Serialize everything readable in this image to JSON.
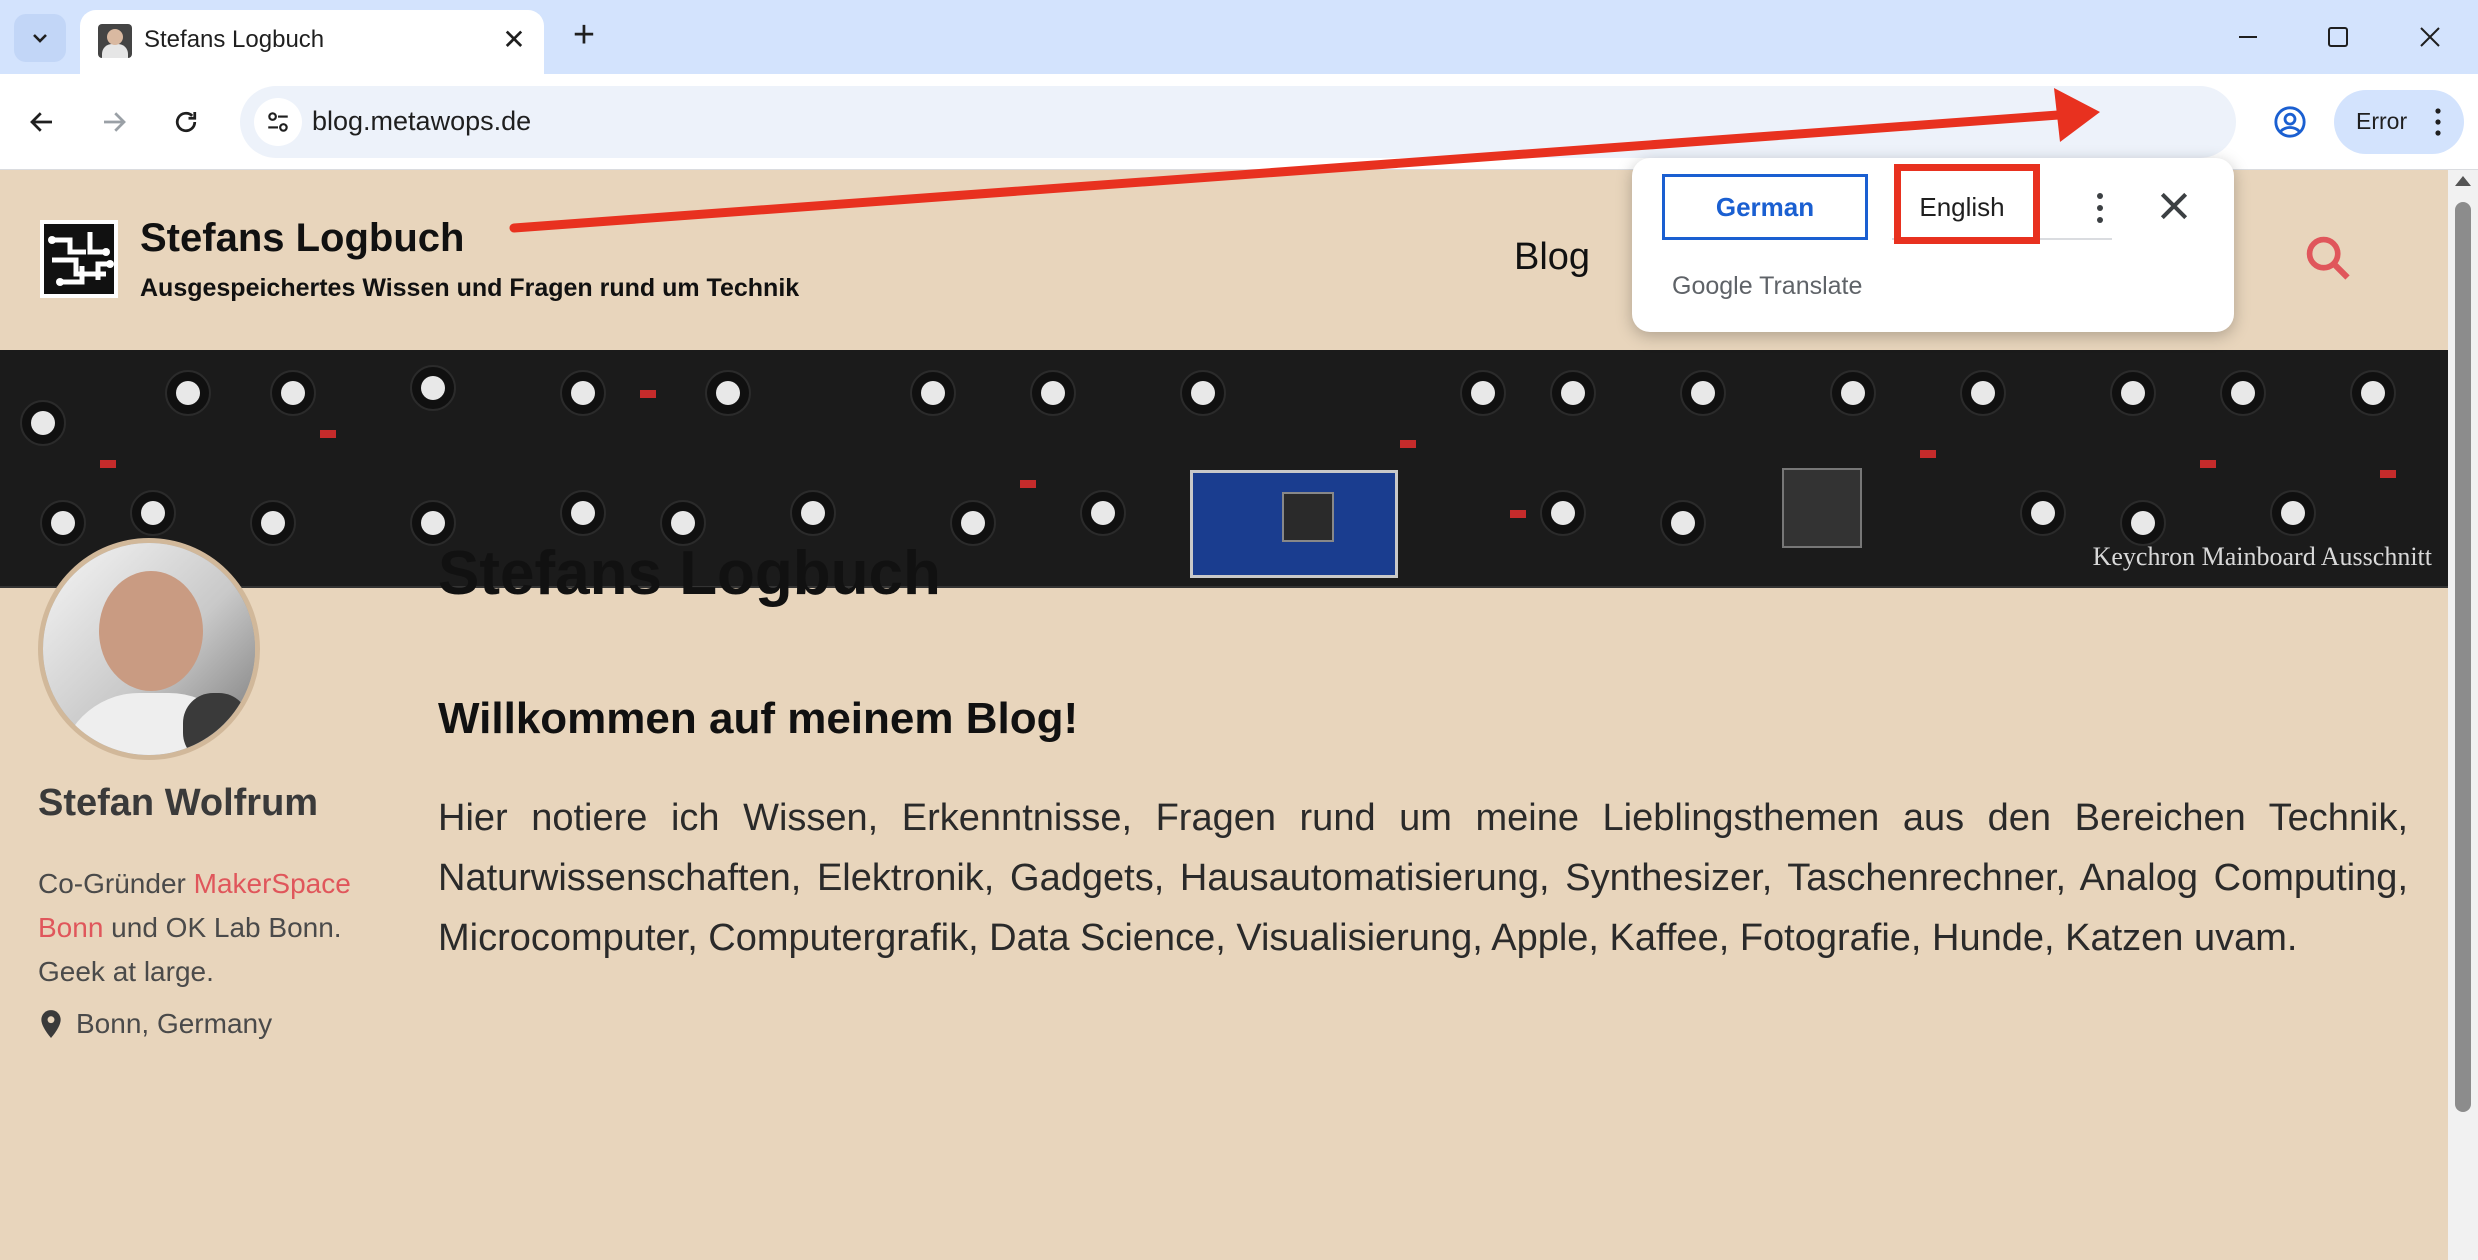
{
  "browser": {
    "tab_title": "Stefans Logbuch",
    "url": "blog.metawops.de",
    "profile_chip_label": "Error"
  },
  "translate_popup": {
    "source_language": "German",
    "target_language": "English",
    "brand_google": "Google",
    "brand_translate": "Translate"
  },
  "header": {
    "site_title": "Stefans Logbuch",
    "tagline": "Ausgespeichertes Wissen und Fragen rund um Technik",
    "nav_blog": "Blog"
  },
  "banner": {
    "caption": "Keychron Mainboard Ausschnitt"
  },
  "sidebar": {
    "author_name": "Stefan Wolfrum",
    "bio_prefix": "Co-Gründer ",
    "bio_link": "MakerSpace Bonn",
    "bio_suffix": " und OK Lab Bonn. Geek at large.",
    "location": "Bonn, Germany"
  },
  "main": {
    "page_title": "Stefans Logbuch",
    "welcome_heading": "Willkommen auf meinem Blog!",
    "intro_text": "Hier notiere ich Wissen, Erkenntnisse, Fragen rund um meine Lieblingsthemen aus den Bereichen Technik, Naturwissenschaften, Elektronik, Gadgets, Hausautomatisierung, Synthesizer, Taschenrechner, Analog Computing, Microcomputer, Computergrafik, Data Science, Visualisierung, Apple, Kaffee, Fotografie, Hunde, Katzen uvam."
  },
  "colors": {
    "page_background": "#e8d5bc",
    "accent_link": "#e0565b",
    "annotation_red": "#e8311f",
    "chrome_blue": "#d3e3fd",
    "translate_blue": "#1a5fd1"
  }
}
